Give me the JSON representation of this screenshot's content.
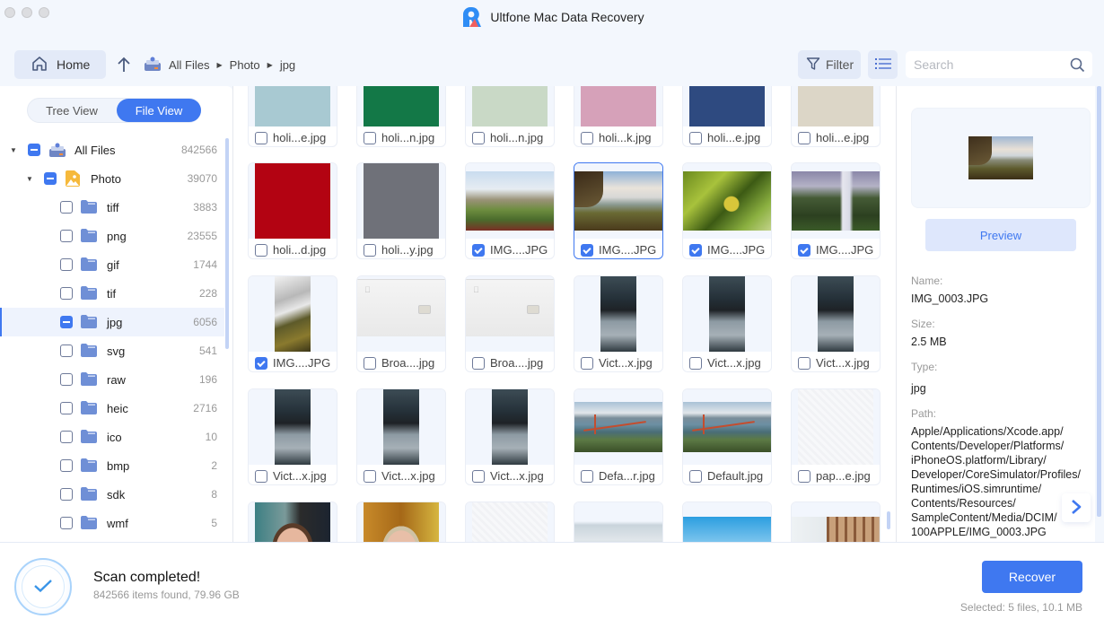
{
  "window": {
    "title": "Ultfone Mac Data Recovery"
  },
  "toolbar": {
    "home_label": "Home",
    "breadcrumb": [
      "All Files",
      "Photo",
      "jpg"
    ],
    "filter_label": "Filter",
    "search_placeholder": "Search",
    "search_value": ""
  },
  "sidebar": {
    "tabs": [
      {
        "label": "Tree View",
        "active": false
      },
      {
        "label": "File View",
        "active": true
      }
    ],
    "tree": [
      {
        "label": "All Files",
        "count": "842566",
        "level": 0,
        "expanded": true,
        "state": "partial",
        "icon": "drive-icon"
      },
      {
        "label": "Photo",
        "count": "39070",
        "level": 1,
        "expanded": true,
        "state": "partial",
        "icon": "photo-folder-icon"
      },
      {
        "label": "tiff",
        "count": "3883",
        "level": 2,
        "state": "unchecked",
        "icon": "folder-icon"
      },
      {
        "label": "png",
        "count": "23555",
        "level": 2,
        "state": "unchecked",
        "icon": "folder-icon"
      },
      {
        "label": "gif",
        "count": "1744",
        "level": 2,
        "state": "unchecked",
        "icon": "folder-icon"
      },
      {
        "label": "tif",
        "count": "228",
        "level": 2,
        "state": "unchecked",
        "icon": "folder-icon"
      },
      {
        "label": "jpg",
        "count": "6056",
        "level": 2,
        "state": "partial",
        "icon": "folder-icon",
        "active": true
      },
      {
        "label": "svg",
        "count": "541",
        "level": 2,
        "state": "unchecked",
        "icon": "folder-icon"
      },
      {
        "label": "raw",
        "count": "196",
        "level": 2,
        "state": "unchecked",
        "icon": "folder-icon"
      },
      {
        "label": "heic",
        "count": "2716",
        "level": 2,
        "state": "unchecked",
        "icon": "folder-icon"
      },
      {
        "label": "ico",
        "count": "10",
        "level": 2,
        "state": "unchecked",
        "icon": "folder-icon"
      },
      {
        "label": "bmp",
        "count": "2",
        "level": 2,
        "state": "unchecked",
        "icon": "folder-icon"
      },
      {
        "label": "sdk",
        "count": "8",
        "level": 2,
        "state": "unchecked",
        "icon": "folder-icon"
      },
      {
        "label": "wmf",
        "count": "5",
        "level": 2,
        "state": "unchecked",
        "icon": "folder-icon"
      }
    ]
  },
  "grid": {
    "files": [
      {
        "name": "holi...e.jpg",
        "checked": false,
        "thumb": "solid",
        "color": "#a8c9d2"
      },
      {
        "name": "holi...n.jpg",
        "checked": false,
        "thumb": "solid",
        "color": "#137847"
      },
      {
        "name": "holi...n.jpg",
        "checked": false,
        "thumb": "solid",
        "color": "#c9d9c6"
      },
      {
        "name": "holi...k.jpg",
        "checked": false,
        "thumb": "solid",
        "color": "#d6a1b9"
      },
      {
        "name": "holi...e.jpg",
        "checked": false,
        "thumb": "solid",
        "color": "#2e4a80"
      },
      {
        "name": "holi...e.jpg",
        "checked": false,
        "thumb": "solid",
        "color": "#dcd6c7"
      },
      {
        "name": "holi...d.jpg",
        "checked": false,
        "thumb": "solid",
        "color": "#b30312"
      },
      {
        "name": "holi...y.jpg",
        "checked": false,
        "thumb": "solid",
        "color": "#6f7179"
      },
      {
        "name": "IMG....JPG",
        "checked": true,
        "thumb": "landscape-dunes"
      },
      {
        "name": "IMG....JPG",
        "checked": true,
        "thumb": "landscape-waterfall",
        "selected": true
      },
      {
        "name": "IMG....JPG",
        "checked": true,
        "thumb": "landscape-leaves"
      },
      {
        "name": "IMG....JPG",
        "checked": true,
        "thumb": "landscape-falls"
      },
      {
        "name": "IMG....JPG",
        "checked": true,
        "thumb": "portrait-stream"
      },
      {
        "name": "Broa....jpg",
        "checked": false,
        "thumb": "card"
      },
      {
        "name": "Broa....jpg",
        "checked": false,
        "thumb": "card"
      },
      {
        "name": "Vict...x.jpg",
        "checked": false,
        "thumb": "portrait-runner"
      },
      {
        "name": "Vict...x.jpg",
        "checked": false,
        "thumb": "portrait-runner"
      },
      {
        "name": "Vict...x.jpg",
        "checked": false,
        "thumb": "portrait-runner"
      },
      {
        "name": "Vict...x.jpg",
        "checked": false,
        "thumb": "portrait-runner"
      },
      {
        "name": "Vict...x.jpg",
        "checked": false,
        "thumb": "portrait-runner"
      },
      {
        "name": "Vict...x.jpg",
        "checked": false,
        "thumb": "portrait-runner"
      },
      {
        "name": "Defa...r.jpg",
        "checked": false,
        "thumb": "landscape-bridge"
      },
      {
        "name": "Default.jpg",
        "checked": false,
        "thumb": "landscape-bridge"
      },
      {
        "name": "pap...e.jpg",
        "checked": false,
        "thumb": "paper"
      },
      {
        "name": "",
        "checked": false,
        "thumb": "portrait-face-man"
      },
      {
        "name": "",
        "checked": false,
        "thumb": "portrait-face-woman"
      },
      {
        "name": "",
        "checked": false,
        "thumb": "paper"
      },
      {
        "name": "",
        "checked": false,
        "thumb": "landscape-sky"
      },
      {
        "name": "",
        "checked": false,
        "thumb": "landscape-mountains"
      },
      {
        "name": "",
        "checked": false,
        "thumb": "landscape-room"
      }
    ]
  },
  "detail": {
    "preview_label": "Preview",
    "fields": [
      {
        "label": "Name:",
        "value": "IMG_0003.JPG"
      },
      {
        "label": "Size:",
        "value": "2.5 MB"
      },
      {
        "label": "Type:",
        "value": "jpg"
      },
      {
        "label": "Path:",
        "value": "Apple/Applications/Xcode.app/ Contents/Developer/Platforms/ iPhoneOS.platform/Library/ Developer/CoreSimulator/Profiles/ Runtimes/iOS.simruntime/ Contents/Resources/ SampleContent/Media/DCIM/ 100APPLE/IMG_0003.JPG"
      }
    ]
  },
  "footer": {
    "status_title": "Scan completed!",
    "status_sub": "842566 items found, 79.96 GB",
    "recover_label": "Recover",
    "selected_info": "Selected: 5 files, 10.1 MB"
  },
  "colors": {
    "accent": "#3f78f0",
    "accent_light": "#dee7fc",
    "background": "#f3f7fd"
  }
}
